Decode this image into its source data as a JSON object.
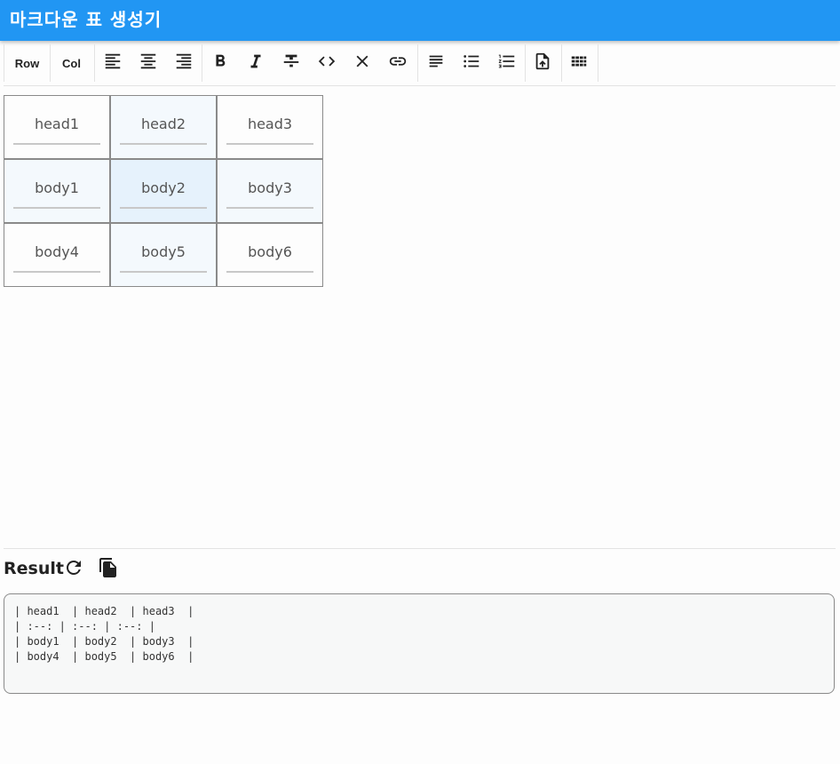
{
  "app": {
    "title": "마크다운 표 생성기"
  },
  "toolbar": {
    "row_label": "Row",
    "col_label": "Col",
    "icons": [
      "align-left-icon",
      "align-center-icon",
      "align-right-icon",
      "bold-icon",
      "italic-icon",
      "strikethrough-icon",
      "code-icon",
      "clear-icon",
      "link-icon",
      "subject-icon",
      "bulleted-list-icon",
      "numbered-list-icon",
      "upload-file-icon",
      "table-grid-icon"
    ]
  },
  "table": {
    "head": [
      "head1",
      "head2",
      "head3"
    ],
    "rows": [
      [
        "body1",
        "body2",
        "body3"
      ],
      [
        "body4",
        "body5",
        "body6"
      ]
    ]
  },
  "result": {
    "title": "Result",
    "markdown": "| head1  | head2  | head3  |\n| :--: | :--: | :--: |\n| body1  | body2  | body3  |\n| body4  | body5  | body6  |"
  },
  "colors": {
    "appbar": "#2196f3",
    "selected_cell": "#e6f2fc",
    "hover_cell": "#f4f9fd"
  }
}
